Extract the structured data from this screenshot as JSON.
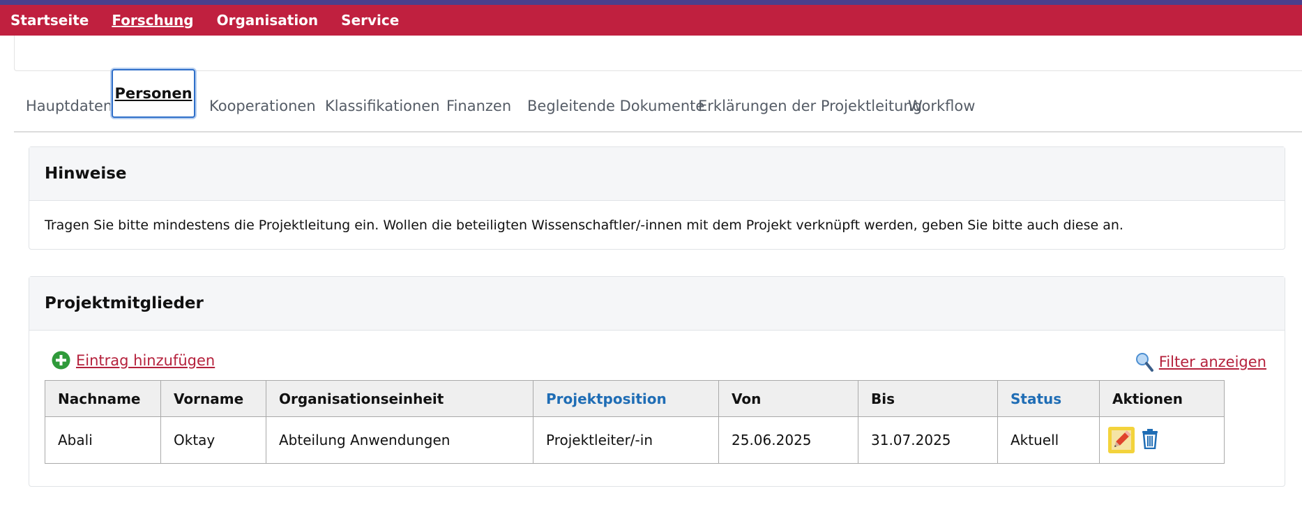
{
  "nav": {
    "items": [
      {
        "label": "Startseite",
        "active": false
      },
      {
        "label": "Forschung",
        "active": true
      },
      {
        "label": "Organisation",
        "active": false
      },
      {
        "label": "Service",
        "active": false
      }
    ]
  },
  "tabs": [
    {
      "label": "Hauptdaten",
      "active": false
    },
    {
      "label": "Personen",
      "active": true
    },
    {
      "label": "Kooperationen",
      "active": false
    },
    {
      "label": "Klassifikationen",
      "active": false
    },
    {
      "label": "Finanzen",
      "active": false
    },
    {
      "label": "Begleitende Dokumente",
      "active": false
    },
    {
      "label": "Erklärungen der Projektleitung",
      "active": false
    },
    {
      "label": "Workflow",
      "active": false
    }
  ],
  "hints": {
    "title": "Hinweise",
    "text": "Tragen Sie bitte mindestens die Projektleitung ein. Wollen die beteiligten Wissenschaftler/-innen mit dem Projekt verknüpft werden, geben Sie bitte auch diese an."
  },
  "members": {
    "title": "Projektmitglieder",
    "add_label": "Eintrag hinzufügen",
    "filter_label": "Filter anzeigen",
    "columns": [
      {
        "label": "Nachname",
        "sortable": false
      },
      {
        "label": "Vorname",
        "sortable": false
      },
      {
        "label": "Organisationseinheit",
        "sortable": false
      },
      {
        "label": "Projektposition",
        "sortable": true
      },
      {
        "label": "Von",
        "sortable": false
      },
      {
        "label": "Bis",
        "sortable": false
      },
      {
        "label": "Status",
        "sortable": true
      },
      {
        "label": "Aktionen",
        "sortable": false
      }
    ],
    "rows": [
      {
        "nachname": "Abali",
        "vorname": "Oktay",
        "organisationseinheit": "Abteilung Anwendungen",
        "projektposition": "Projektleiter/-in",
        "von": "25.06.2025",
        "bis": "31.07.2025",
        "status": "Aktuell"
      }
    ]
  },
  "colors": {
    "brand": "#c0203f",
    "link": "#b5213c",
    "sort_header": "#1f6db5",
    "edit_highlight": "#f3d33c"
  },
  "icons": {
    "add": "plus-circle-icon",
    "filter": "magnifier-icon",
    "edit": "pencil-icon",
    "delete": "trash-icon"
  }
}
